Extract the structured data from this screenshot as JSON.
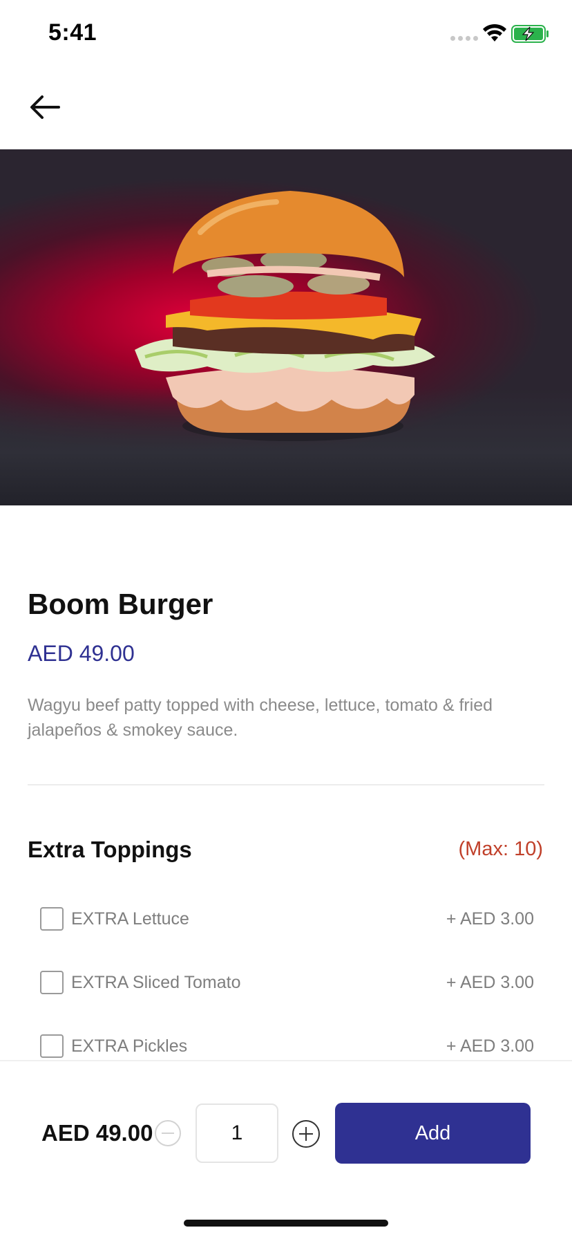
{
  "status_bar": {
    "time": "5:41"
  },
  "header": {
    "back_icon": "arrow-left-icon"
  },
  "hero": {
    "image": "burger-photo",
    "accent_color": "#d4003a"
  },
  "product": {
    "name": "Boom Burger",
    "price": "AED 49.00",
    "description": "Wagyu beef patty topped with cheese, lettuce, tomato & fried jalapeños & smokey sauce."
  },
  "extras": {
    "title": "Extra Toppings",
    "max": "(Max: 10)",
    "items": [
      {
        "label": "EXTRA Lettuce",
        "price": "+ AED 3.00",
        "checked": false
      },
      {
        "label": "EXTRA Sliced Tomato",
        "price": "+ AED 3.00",
        "checked": false
      },
      {
        "label": "EXTRA Pickles",
        "price": "+ AED 3.00",
        "checked": false
      }
    ]
  },
  "footer": {
    "total": "AED 49.00",
    "quantity": "1",
    "add_label": "Add",
    "brand_color": "#2f3192"
  }
}
